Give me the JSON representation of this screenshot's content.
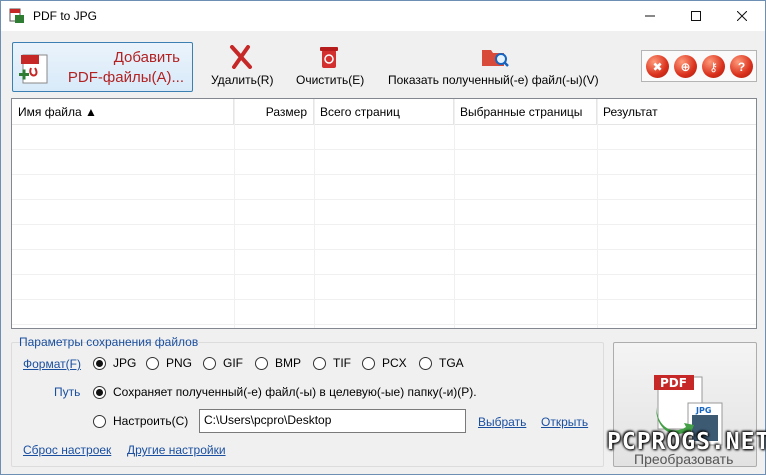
{
  "window": {
    "title": "PDF to JPG"
  },
  "toolbar": {
    "add_line1": "Добавить",
    "add_line2": "PDF-файлы(A)...",
    "delete": "Удалить(R)",
    "clear": "Очистить(E)",
    "show_output": "Показать полученный(-е) файл(-ы)(V)"
  },
  "table": {
    "columns": [
      "Имя файла ▲",
      "Размер",
      "Всего страниц",
      "Выбранные страницы",
      "Результат"
    ]
  },
  "settings": {
    "group_title": "Параметры сохранения файлов",
    "format_label": "Формат(F)",
    "formats": [
      "JPG",
      "PNG",
      "GIF",
      "BMP",
      "TIF",
      "PCX",
      "TGA"
    ],
    "selected_format": "JPG",
    "path_label": "Путь",
    "save_to_source": "Сохраняет полученный(-е) файл(-ы) в целевую(-ые) папку(-и)(P).",
    "custom": "Настроить(C)",
    "custom_path": "C:\\Users\\pcpro\\Desktop",
    "browse": "Выбрать",
    "open": "Открыть",
    "reset": "Сброс настроек",
    "other_settings": "Другие настройки"
  },
  "convert": {
    "icon_pdf": "PDF",
    "icon_jpg": "JPG",
    "label": "Преобразовать"
  },
  "watermark": "PCPROGS.NET",
  "colors": {
    "accent": "#1a4fa0",
    "brand_red": "#b22222"
  }
}
